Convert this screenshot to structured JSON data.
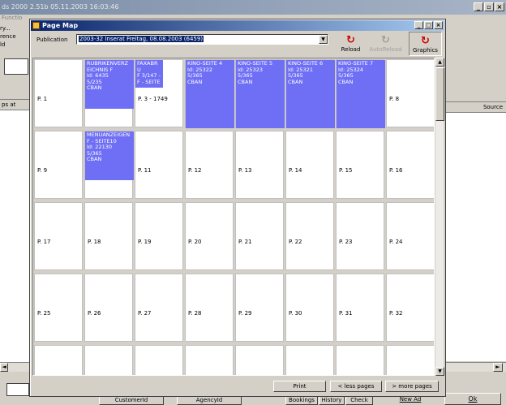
{
  "background": {
    "window_title": "ds 2000 2.51b 05.11.2003 16:03:46",
    "menu_fragment": "Functio",
    "left_labels": [
      "ry...",
      "rence",
      "ld"
    ],
    "left_column_header": "ps at",
    "right_column_header": "Source",
    "bottom_labels": {
      "customer_id": "CustomerId",
      "agency_id": "AgencyId",
      "bookings": "Bookings",
      "history": "History",
      "check": "Check",
      "new_ad": "New Ad",
      "ok": "Ok"
    }
  },
  "dialog": {
    "title": "Page Map",
    "publication_label": "Publication",
    "publication_value": "2003-32 Inserat Freitag, 08.08.2003 (6459)",
    "toolbar": {
      "reload": "Reload",
      "autoreload": "AutoReload",
      "graphics": "Graphics"
    },
    "pages": [
      {
        "label": "P. 1",
        "ad": null
      },
      {
        "label": "",
        "ad": {
          "lines": [
            "RUBRIKENVERZ",
            "EICHNIS F",
            "Id: 6435",
            "5/235",
            "CBAN"
          ]
        }
      },
      {
        "label": "P. 3 - 1749",
        "ad": {
          "lines": [
            "FAXABRU",
            "F 3/147 -",
            "F - SEITE"
          ]
        }
      },
      {
        "label": "",
        "ad": {
          "lines": [
            "KINO-SEITE 4",
            "Id: 25322",
            "5/365",
            "CBAN"
          ]
        }
      },
      {
        "label": "",
        "ad": {
          "lines": [
            "KINO-SEITE 5",
            "Id: 25323",
            "5/365",
            "CBAN"
          ]
        }
      },
      {
        "label": "",
        "ad": {
          "lines": [
            "KINO-SEITE 6",
            "Id: 25321",
            "5/365",
            "CBAN"
          ]
        }
      },
      {
        "label": "",
        "ad": {
          "lines": [
            "KINO-SEITE 7",
            "Id: 25324",
            "5/365",
            "CBAN"
          ]
        }
      },
      {
        "label": "P. 8",
        "ad": null
      },
      {
        "label": "P. 9",
        "ad": null
      },
      {
        "label": "",
        "ad": {
          "lines": [
            "MENUANZEIGEN",
            "F - SEITE10",
            "Id: 22130",
            "5/365",
            "CBAN"
          ]
        }
      },
      {
        "label": "P. 11",
        "ad": null
      },
      {
        "label": "P. 12",
        "ad": null
      },
      {
        "label": "P. 13",
        "ad": null
      },
      {
        "label": "P. 14",
        "ad": null
      },
      {
        "label": "P. 15",
        "ad": null
      },
      {
        "label": "P. 16",
        "ad": null
      },
      {
        "label": "P. 17",
        "ad": null
      },
      {
        "label": "P. 18",
        "ad": null
      },
      {
        "label": "P. 19",
        "ad": null
      },
      {
        "label": "P. 20",
        "ad": null
      },
      {
        "label": "P. 21",
        "ad": null
      },
      {
        "label": "P. 22",
        "ad": null
      },
      {
        "label": "P. 23",
        "ad": null
      },
      {
        "label": "P. 24",
        "ad": null
      },
      {
        "label": "P. 25",
        "ad": null
      },
      {
        "label": "P. 26",
        "ad": null
      },
      {
        "label": "P. 27",
        "ad": null
      },
      {
        "label": "P. 28",
        "ad": null
      },
      {
        "label": "P. 29",
        "ad": null
      },
      {
        "label": "P. 30",
        "ad": null
      },
      {
        "label": "P. 31",
        "ad": null
      },
      {
        "label": "P. 32",
        "ad": null
      },
      {
        "label": "",
        "ad": null
      },
      {
        "label": "",
        "ad": null
      },
      {
        "label": "",
        "ad": null
      },
      {
        "label": "",
        "ad": null
      },
      {
        "label": "",
        "ad": null
      },
      {
        "label": "",
        "ad": null
      },
      {
        "label": "",
        "ad": null
      },
      {
        "label": "",
        "ad": null
      }
    ],
    "buttons": {
      "print": "Print",
      "less_pages": "< less pages",
      "more_pages": "> more pages"
    },
    "colors": {
      "ad_fill": "#6f6ff5",
      "titlebar": "#0a246a",
      "accent_icon": "#d00000"
    }
  }
}
